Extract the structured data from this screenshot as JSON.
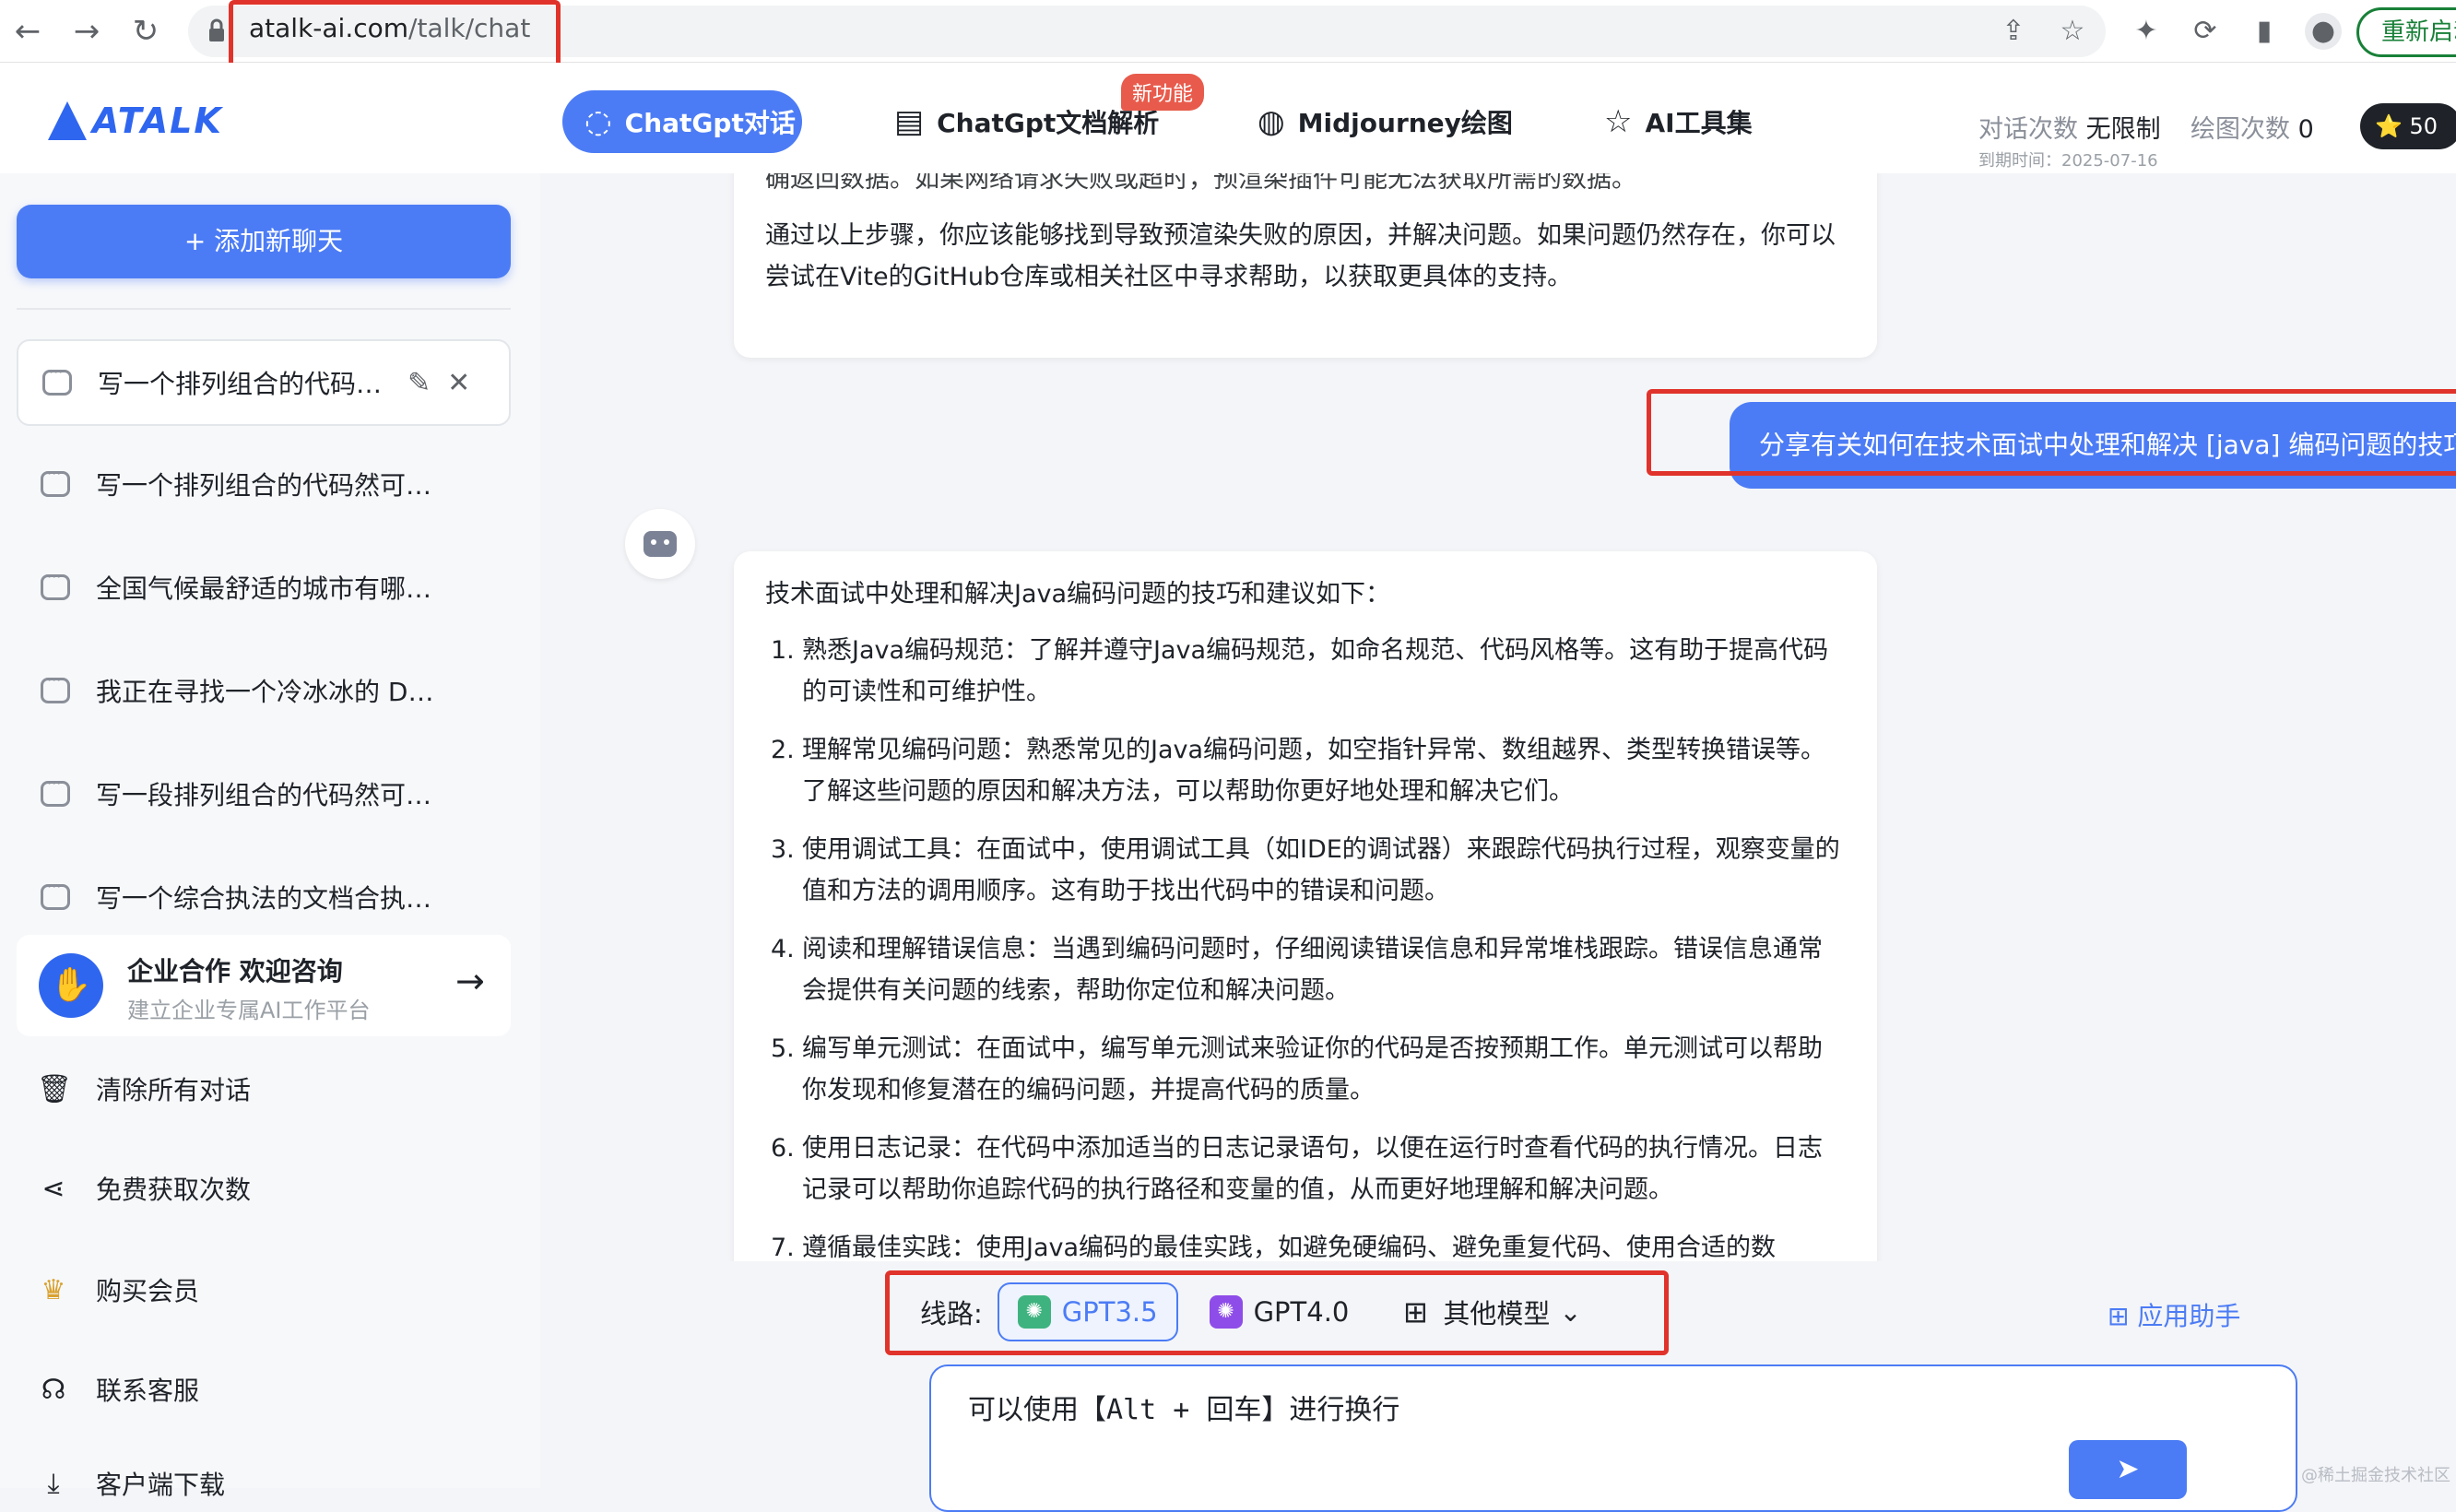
{
  "browser": {
    "back_icon": "←",
    "forward_icon": "→",
    "reload_icon": "↻",
    "url_domain": "atalk-ai.com",
    "url_path": "/talk/chat",
    "share_icon": "⇪",
    "bookmark_icon": "☆",
    "extension_icon": "✦",
    "sidepanel_icon": "▮",
    "restart_label": "重新启动"
  },
  "header": {
    "logo_text": "ATALK",
    "tabs": [
      {
        "label": "ChatGpt对话",
        "icon": "◌"
      },
      {
        "label": "ChatGpt文档解析",
        "icon": "▤"
      },
      {
        "label": "Midjourney绘图",
        "icon": "◍"
      },
      {
        "label": "AI工具集",
        "icon": "☆"
      }
    ],
    "new_badge": "新功能",
    "chat_quota_label": "对话次数",
    "chat_quota_value": "无限制",
    "draw_quota_label": "绘图次数",
    "draw_quota_value": "0",
    "expire_text": "到期时间：2025-07-16",
    "stars": "⭐ 50"
  },
  "sidebar": {
    "add_chat": "+ 添加新聊天",
    "conversations": [
      "写一个排列组合的代码…",
      "写一个排列组合的代码然可以！…",
      "全国气候最舒适的城市有哪些国…",
      "我正在寻找一个冷冰冰的 DM 想…",
      "写一段排列组合的代码然可以！…",
      "写一个综合执法的文档合执法是…"
    ],
    "edit_icon": "✎",
    "close_icon": "✕",
    "promo_title": "企业合作 欢迎咨询",
    "promo_sub": "建立企业专属AI工作平台",
    "promo_arrow": "→",
    "menu": [
      {
        "label": "清除所有对话",
        "icon": "🗑"
      },
      {
        "label": "免费获取次数",
        "icon": "⋖"
      },
      {
        "label": "购买会员",
        "icon": "♛"
      },
      {
        "label": "联系客服",
        "icon": "☊"
      },
      {
        "label": "客户端下载",
        "icon": "⤓"
      }
    ]
  },
  "chat": {
    "prev_tail": "确返回数据。如果网络请求失败或超时，预渲染插件可能无法获取所需的数据。",
    "prev_para": "通过以上步骤，你应该能够找到导致预渲染失败的原因，并解决问题。如果问题仍然存在，你可以尝试在Vite的GitHub仓库或相关社区中寻求帮助，以获取更具体的支持。",
    "user_message": "分享有关如何在技术面试中处理和解决 [java] 编码问题的技巧和建议",
    "answer_intro": "技术面试中处理和解决Java编码问题的技巧和建议如下：",
    "answer_items": [
      "熟悉Java编码规范：了解并遵守Java编码规范，如命名规范、代码风格等。这有助于提高代码的可读性和可维护性。",
      "理解常见编码问题：熟悉常见的Java编码问题，如空指针异常、数组越界、类型转换错误等。了解这些问题的原因和解决方法，可以帮助你更好地处理和解决它们。",
      "使用调试工具：在面试中，使用调试工具（如IDE的调试器）来跟踪代码执行过程，观察变量的值和方法的调用顺序。这有助于找出代码中的错误和问题。",
      "阅读和理解错误信息：当遇到编码问题时，仔细阅读错误信息和异常堆栈跟踪。错误信息通常会提供有关问题的线索，帮助你定位和解决问题。",
      "编写单元测试：在面试中，编写单元测试来验证你的代码是否按预期工作。单元测试可以帮助你发现和修复潜在的编码问题，并提高代码的质量。",
      "使用日志记录：在代码中添加适当的日志记录语句，以便在运行时查看代码的执行情况。日志记录可以帮助你追踪代码的执行路径和变量的值，从而更好地理解和解决问题。",
      "遵循最佳实践：使用Java编码的最佳实践，如避免硬编码、避免重复代码、使用合适的数"
    ]
  },
  "input": {
    "route_label": "线路:",
    "models": [
      "GPT3.5",
      "GPT4.0"
    ],
    "other_models": "其他模型",
    "app_helper": "应用助手",
    "placeholder": "可以使用【Alt + 回车】进行换行",
    "send_icon": "➤"
  },
  "watermark": "@稀土掘金技术社区",
  "colors": {
    "accent": "#4c7cf5",
    "highlight": "#e0332b"
  }
}
